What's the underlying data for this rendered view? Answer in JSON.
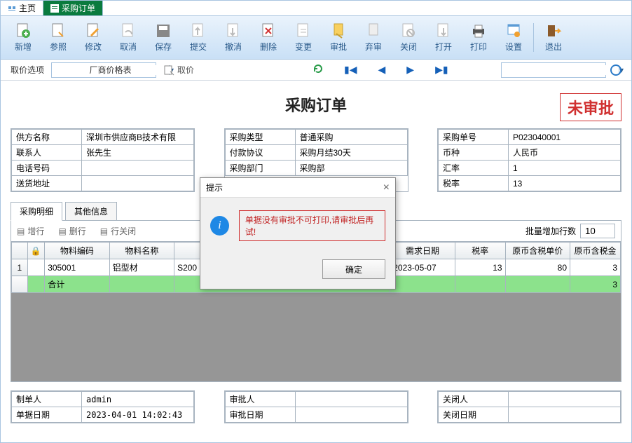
{
  "tabs": {
    "home": "主页",
    "current": "采购订单"
  },
  "toolbar": {
    "new": "新增",
    "ref": "参照",
    "edit": "修改",
    "cancel": "取消",
    "save": "保存",
    "submit": "提交",
    "revoke": "撤消",
    "delete": "删除",
    "change": "变更",
    "approve": "审批",
    "abandon": "弃审",
    "close": "关闭",
    "open": "打开",
    "print": "打印",
    "setting": "设置",
    "exit": "退出"
  },
  "filter": {
    "pricing_label": "取价选项",
    "pricing_value": "厂商价格表",
    "getprice_label": "取价"
  },
  "doc": {
    "title": "采购订单",
    "status": "未审批"
  },
  "supplier": {
    "name_k": "供方名称",
    "name_v": "深圳市供应商B技术有限",
    "contact_k": "联系人",
    "contact_v": "张先生",
    "phone_k": "电话号码",
    "phone_v": "",
    "addr_k": "送货地址",
    "addr_v": ""
  },
  "purchase": {
    "type_k": "采购类型",
    "type_v": "普通采购",
    "pay_k": "付款协议",
    "pay_v": "采购月结30天",
    "dept_k": "采购部门",
    "dept_v": "采购部"
  },
  "order": {
    "no_k": "采购单号",
    "no_v": "P023040001",
    "currency_k": "币种",
    "currency_v": "人民币",
    "rate_k": "汇率",
    "rate_v": "1",
    "tax_k": "税率",
    "tax_v": "13"
  },
  "subtabs": {
    "detail": "采购明细",
    "other": "其他信息"
  },
  "gridtools": {
    "addrow": "增行",
    "delrow": "删行",
    "closerow": "行关闭",
    "batch_label": "批量增加行数",
    "batch_value": "10"
  },
  "grid": {
    "headers": {
      "code": "物料编码",
      "name": "物料名称",
      "spec": "",
      "reqdate": "需求日期",
      "taxrate": "税率",
      "unitprice": "原币含税单价",
      "amount": "原币含税金"
    },
    "row": {
      "num": "1",
      "code": "305001",
      "name": "铝型材",
      "spec": "S200",
      "reqdate": "2023-05-07",
      "taxrate": "13",
      "unitprice": "80",
      "amount": "3"
    },
    "total_label": "合计",
    "total_amount": "3"
  },
  "footer": {
    "maker_k": "制单人",
    "maker_v": "admin",
    "date_k": "单据日期",
    "date_v": "2023-04-01 14:02:43",
    "approver_k": "审批人",
    "approve_date_k": "审批日期",
    "closer_k": "关闭人",
    "close_date_k": "关闭日期"
  },
  "modal": {
    "title": "提示",
    "message": "单据没有审批不可打印,请审批后再试!",
    "ok": "确定"
  }
}
